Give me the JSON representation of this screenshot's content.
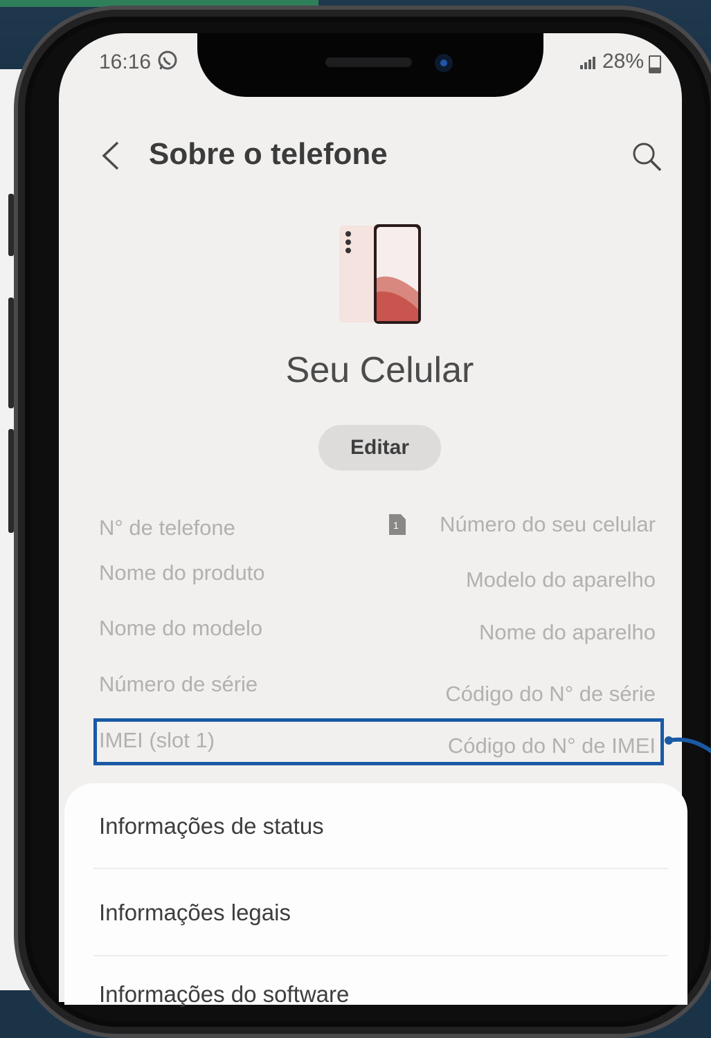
{
  "status_bar": {
    "time": "16:16",
    "battery": "28%"
  },
  "header": {
    "title": "Sobre o telefone"
  },
  "device": {
    "name": "Seu Celular",
    "edit_label": "Editar"
  },
  "info": [
    {
      "label": "N° de telefone",
      "value": "Número do seu celular"
    },
    {
      "label": "Nome do produto",
      "value": "Modelo do aparelho"
    },
    {
      "label": "Nome do modelo",
      "value": "Nome do aparelho"
    },
    {
      "label": "Número de série",
      "value": "Código do N° de série"
    },
    {
      "label": "IMEI (slot 1)",
      "value": "Código do N° de IMEI"
    }
  ],
  "menu": [
    {
      "label": "Informações de status"
    },
    {
      "label": "Informações legais"
    },
    {
      "label": "Informações do software"
    }
  ],
  "colors": {
    "highlight": "#1a5aa5",
    "background": "#1b3347"
  },
  "icons": [
    "back-arrow-icon",
    "search-icon",
    "sim-card-icon",
    "whatsapp-icon",
    "signal-icon",
    "battery-icon"
  ]
}
